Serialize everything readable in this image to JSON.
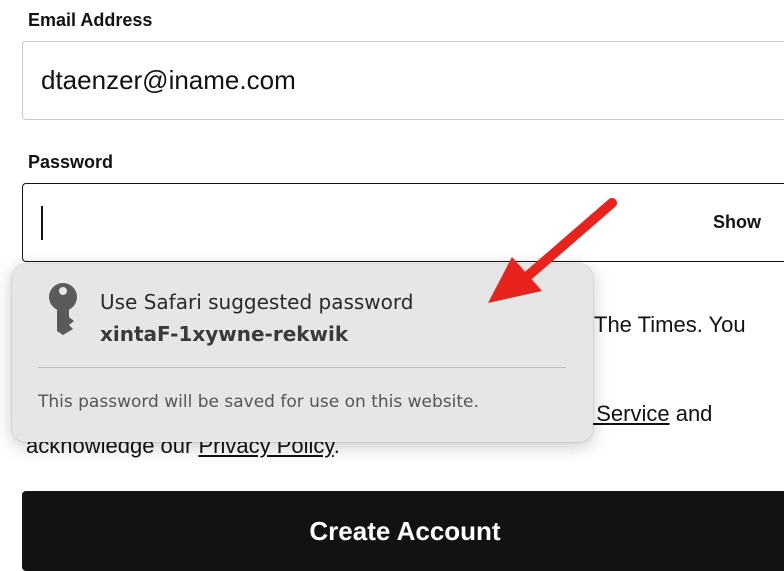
{
  "form": {
    "email_label": "Email Address",
    "email_value": "dtaenzer@iname.com",
    "password_label": "Password",
    "password_value": "",
    "show_label": "Show",
    "terms_fragment_1": "The Times. You",
    "terms_fragment_2": "f Service",
    "terms_fragment_2_suffix": " and",
    "terms_fragment_3_prefix": "acknowledge our ",
    "privacy_link": "Privacy Policy",
    "terms_fragment_3_suffix": ".",
    "create_button_label": "Create Account"
  },
  "password_suggestion": {
    "title": "Use Safari suggested password",
    "suggested_password": "xintaF-1xywne-rekwik",
    "note": "This password will be saved for use on this website.",
    "icon": "key-icon"
  },
  "annotation": {
    "arrow_color": "#e8231d",
    "icon": "arrow-annotation"
  },
  "colors": {
    "button_background": "#121212",
    "popup_background": "#e6e6e6"
  }
}
